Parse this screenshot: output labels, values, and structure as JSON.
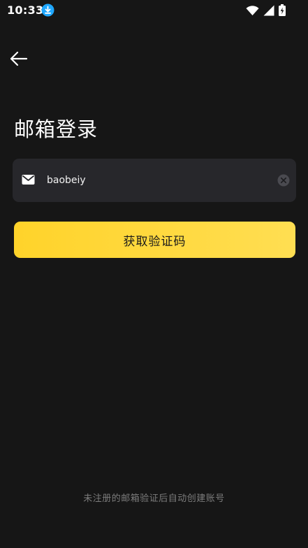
{
  "status_bar": {
    "time": "10:33",
    "icons": [
      "download-icon",
      "wifi-icon",
      "signal-icon",
      "battery-charging-icon"
    ]
  },
  "header": {
    "back_icon": "arrow-left-icon"
  },
  "page": {
    "title": "邮箱登录"
  },
  "email_field": {
    "icon": "mail-icon",
    "value": "baobeiy",
    "clear_icon": "clear-circle-icon"
  },
  "submit": {
    "label": "获取验证码"
  },
  "footer": {
    "note": "未注册的邮箱验证后自动创建账号"
  },
  "colors": {
    "background": "#161616",
    "field_background": "#27272b",
    "accent": "#ffd32a",
    "footer_text": "#7c7c7c",
    "status_download": "#1fa7ff"
  }
}
